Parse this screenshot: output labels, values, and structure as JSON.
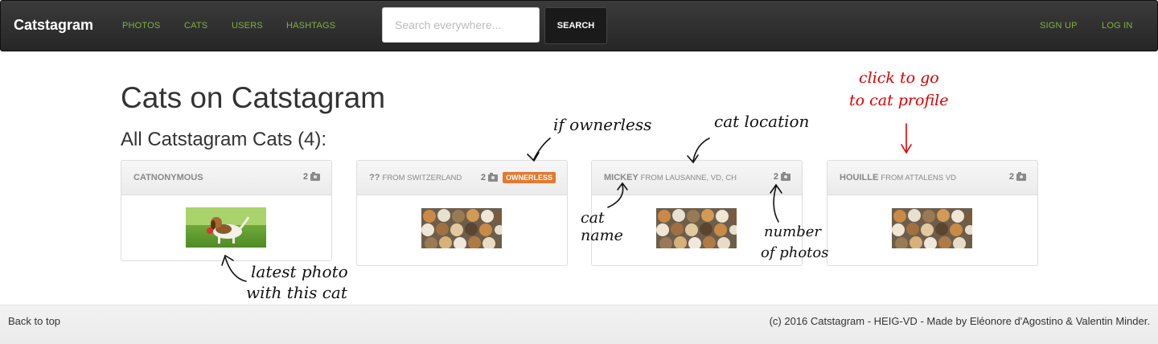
{
  "nav": {
    "brand": "Catstagram",
    "links": [
      "PHOTOS",
      "CATS",
      "USERS",
      "HASHTAGS"
    ],
    "search_placeholder": "Search everywhere...",
    "search_button": "SEARCH",
    "signup": "SIGN UP",
    "login": "LOG IN"
  },
  "page": {
    "title": "Cats on Catstagram",
    "subtitle": "All Catstagram Cats (4):"
  },
  "cats": [
    {
      "name": "CATNONYMOUS",
      "from": "",
      "photos": "2",
      "badge": "",
      "photo_icon": "beagle-photo"
    },
    {
      "name": "??",
      "from": "FROM SWITZERLAND",
      "photos": "2",
      "badge": "OWNERLESS",
      "photo_icon": "cats-photo"
    },
    {
      "name": "MICKEY",
      "from": "FROM LAUSANNE, VD, CH",
      "photos": "2",
      "badge": "",
      "photo_icon": "cats-photo"
    },
    {
      "name": "HOUILLE",
      "from": "FROM ATTALENS VD",
      "photos": "2",
      "badge": "",
      "photo_icon": "cats-photo"
    }
  ],
  "annotations": {
    "ownerless": "if ownerless",
    "location": "cat location",
    "profile_line1": "click to go",
    "profile_line2": "to cat profile",
    "name_line1": "cat",
    "name_line2": "name",
    "photos_line1": "number",
    "photos_line2": "of photos",
    "latest_line1": "latest photo",
    "latest_line2": "with this cat"
  },
  "footer": {
    "back_to_top": "Back to top",
    "copyright": "(c) 2016 ",
    "brand": "Catstagram - HEIG-VD",
    "made_by": " - Made by ",
    "author1": "Eléonore d'Agostino",
    "amp": " & ",
    "author2": "Valentin Minder",
    "end": "."
  },
  "colors": {
    "accent_green": "#7fb33d",
    "badge_orange": "#e5782f",
    "annotation_red": "#d90000"
  }
}
